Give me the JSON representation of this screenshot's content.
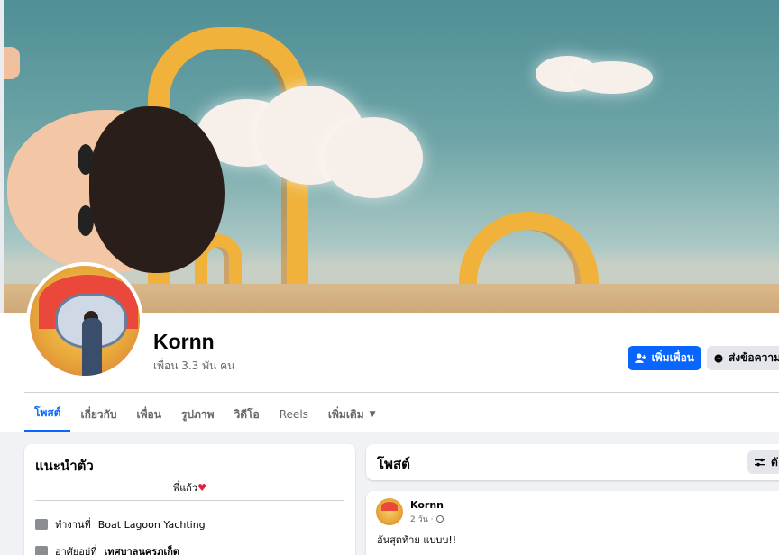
{
  "profile": {
    "name": "Kornn",
    "friends_count": "เพื่อน 3.3 พัน คน"
  },
  "actions": {
    "add_friend": "เพิ่มเพื่อน",
    "message": "ส่งข้อความ"
  },
  "tabs": [
    {
      "label": "โพสต์",
      "active": true
    },
    {
      "label": "เกี่ยวกับ"
    },
    {
      "label": "เพื่อน"
    },
    {
      "label": "รูปภาพ"
    },
    {
      "label": "วิดีโอ"
    },
    {
      "label": "Reels"
    },
    {
      "label": "เพิ่มเติม"
    }
  ],
  "intro": {
    "title": "แนะนำตัว",
    "bio": "พี่แก้ว",
    "items": [
      {
        "prefix": "ทำงานที่",
        "value": "Boat Lagoon Yachting"
      },
      {
        "prefix": "อาศัยอยู่ที่",
        "value": "เทศบาลนครภูเก็ต"
      }
    ]
  },
  "posts_section": {
    "title": "โพสต์",
    "filter_label": "ตั"
  },
  "post": {
    "author": "Kornn",
    "time": "2 วัน ·",
    "text": "อันสุดท้าย แบบบ!!"
  },
  "colors": {
    "primary": "#0866ff",
    "heart": "#e41e3f"
  }
}
